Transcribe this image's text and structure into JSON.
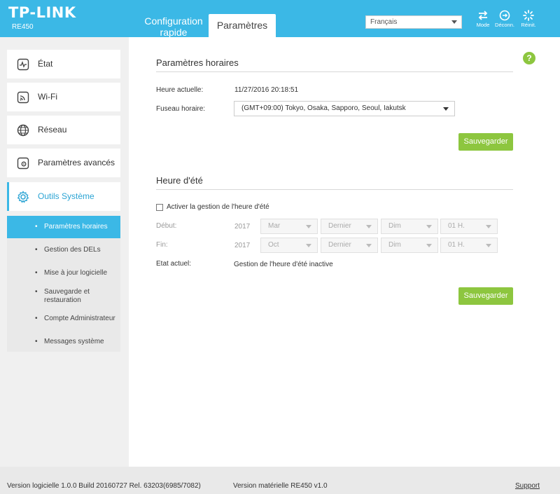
{
  "header": {
    "logo": "TP-LINK",
    "model": "RE450",
    "tabs": [
      {
        "label": "Configuration rapide"
      },
      {
        "label": "Paramètres"
      }
    ],
    "language": "Français",
    "buttons": [
      {
        "label": "Mode",
        "icon": "mode-icon"
      },
      {
        "label": "Déconn.",
        "icon": "logout-icon"
      },
      {
        "label": "Réinit.",
        "icon": "reboot-icon"
      }
    ],
    "accent_color": "#3bb8e6"
  },
  "sidebar": {
    "items": [
      {
        "label": "État",
        "icon": "status-icon"
      },
      {
        "label": "Wi-Fi",
        "icon": "wifi-icon"
      },
      {
        "label": "Réseau",
        "icon": "globe-icon"
      },
      {
        "label": "Paramètres avancés",
        "icon": "advanced-settings-icon"
      },
      {
        "label": "Outils Système",
        "icon": "gear-icon"
      }
    ],
    "subitems": [
      {
        "label": "Paramètres horaires"
      },
      {
        "label": "Gestion des DELs"
      },
      {
        "label": "Mise à jour logicielle"
      },
      {
        "label": "Sauvegarde et restauration"
      },
      {
        "label": "Compte Administrateur"
      },
      {
        "label": "Messages système"
      }
    ]
  },
  "time_settings": {
    "title": "Paramètres horaires",
    "current_time_label": "Heure actuelle:",
    "current_time": "11/27/2016 20:18:51",
    "timezone_label": "Fuseau horaire:",
    "timezone": "(GMT+09:00) Tokyo, Osaka, Sapporo, Seoul, Iakutsk",
    "save_label": "Sauvegarder"
  },
  "dst": {
    "title": "Heure d'été",
    "enable_label": "Activer la gestion de l'heure d'été",
    "start_label": "Début:",
    "start_year": "2017",
    "start_month": "Mar",
    "start_week": "Dernier",
    "start_day": "Dim",
    "start_hour": "01 H.",
    "end_label": "Fin:",
    "end_year": "2017",
    "end_month": "Oct",
    "end_week": "Dernier",
    "end_day": "Dim",
    "end_hour": "01 H.",
    "status_label": "Etat actuel:",
    "status_value": "Gestion de l'heure d'été inactive",
    "save_label": "Sauvegarder"
  },
  "footer": {
    "firmware": "Version logicielle 1.0.0 Build 20160727 Rel. 63203(6985/7082)",
    "hardware": "Version matérielle RE450 v1.0",
    "support": "Support"
  }
}
